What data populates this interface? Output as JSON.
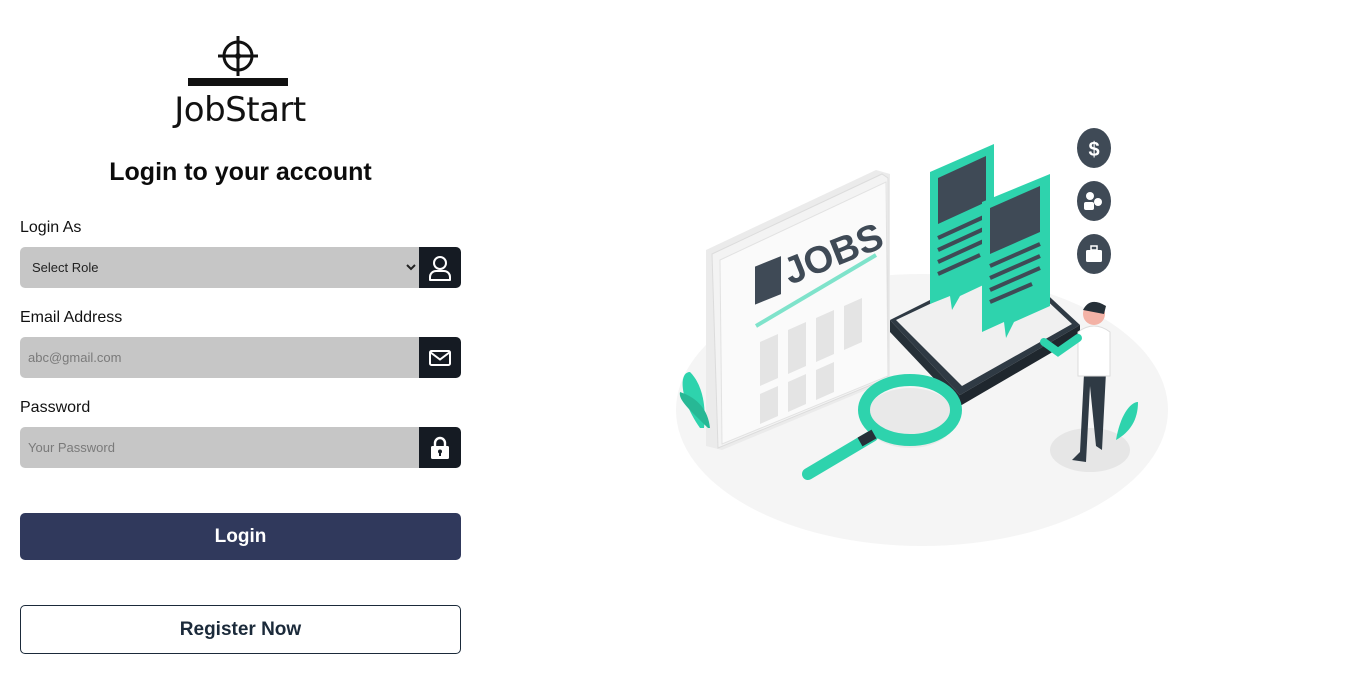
{
  "brand": {
    "name": "JobStart"
  },
  "heading": "Login to your account",
  "form": {
    "role": {
      "label": "Login As",
      "selected": "Select Role",
      "options": [
        "Select Role"
      ]
    },
    "email": {
      "label": "Email Address",
      "placeholder": "abc@gmail.com",
      "value": ""
    },
    "password": {
      "label": "Password",
      "placeholder": "Your Password",
      "value": ""
    },
    "login_label": "Login",
    "register_label": "Register Now"
  },
  "illustration": {
    "sign_text": "JOBS"
  },
  "colors": {
    "primary": "#30395c",
    "icon_box": "#151b23",
    "input_bg": "#c6c6c6",
    "accent": "#2ed3ad"
  },
  "icons": [
    "crosshair-logo-icon",
    "user-icon",
    "mail-icon",
    "lock-icon",
    "dollar-icon",
    "people-icon",
    "briefcase-icon"
  ]
}
